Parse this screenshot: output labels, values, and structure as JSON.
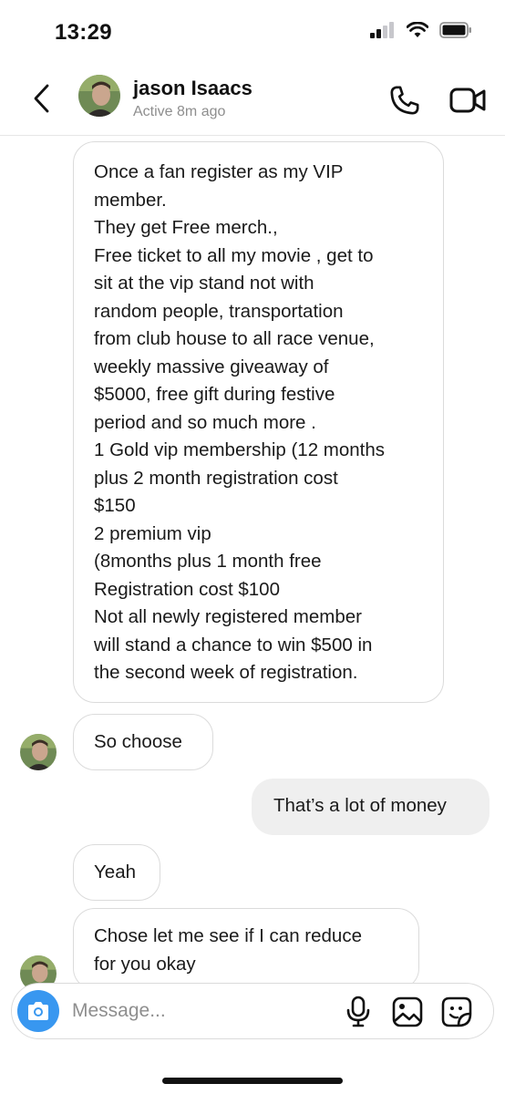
{
  "status_bar": {
    "time": "13:29"
  },
  "header": {
    "contact_name": "jason Isaacs",
    "contact_status": "Active 8m ago"
  },
  "messages": [
    {
      "sender": "them",
      "lines": [
        "Once a fan register as my VIP",
        "member.",
        "They get Free merch.,",
        "Free ticket to all my movie , get to",
        "sit at the vip stand not with",
        "random people, transportation",
        "from club house to all race venue,",
        "weekly massive giveaway of",
        "$5000, free gift during festive",
        "period and so much more .",
        "1 Gold vip membership (12 months",
        "plus 2 month registration cost",
        "$150",
        "2 premium vip",
        "(8months plus 1 month free",
        "Registration cost $100",
        "Not all newly registered member",
        "will stand a chance to win  $500 in",
        "the second week of registration."
      ]
    },
    {
      "sender": "them",
      "text": "So choose"
    },
    {
      "sender": "me",
      "text": "That’s a lot of money"
    },
    {
      "sender": "them",
      "text": "Yeah"
    },
    {
      "sender": "them",
      "lines": [
        "Chose let me see if I can reduce",
        "for you okay"
      ]
    }
  ],
  "composer": {
    "placeholder": "Message..."
  },
  "icons": {
    "back": "chevron-left-icon",
    "call": "phone-icon",
    "video": "video-camera-icon",
    "camera": "camera-icon",
    "mic": "microphone-icon",
    "gallery": "image-icon",
    "sticker": "sticker-icon"
  },
  "colors": {
    "accent": "#3897f0",
    "my_bubble": "#efefef",
    "muted_text": "#8e8e8e"
  }
}
